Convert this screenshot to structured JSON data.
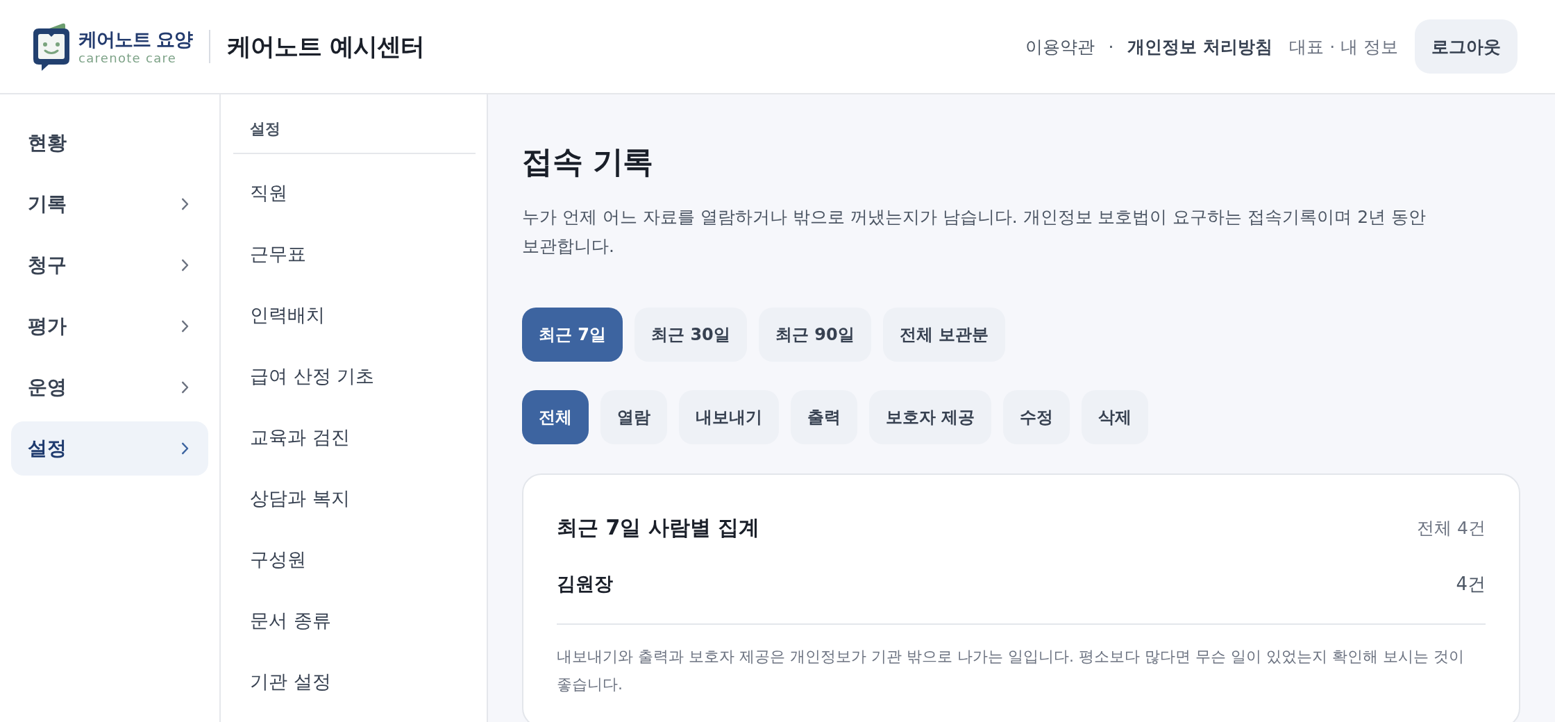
{
  "header": {
    "logo": {
      "name": "케어노트 요양",
      "tagline": "carenote care"
    },
    "center_name": "케어노트 예시센터",
    "links": [
      {
        "label": "이용약관",
        "kind": "plain"
      },
      {
        "label": "개인정보 처리방침",
        "kind": "strong"
      }
    ],
    "link_separator": "·",
    "account": "대표 · 내 정보",
    "logout_button": "로그아웃"
  },
  "sidebar": {
    "items": [
      {
        "label": "현황",
        "expandable": false,
        "selected": false
      },
      {
        "label": "기록",
        "expandable": true,
        "selected": false
      },
      {
        "label": "청구",
        "expandable": true,
        "selected": false
      },
      {
        "label": "평가",
        "expandable": true,
        "selected": false
      },
      {
        "label": "운영",
        "expandable": true,
        "selected": false
      },
      {
        "label": "설정",
        "expandable": true,
        "selected": true
      }
    ]
  },
  "submenu": {
    "title": "설정",
    "items": [
      {
        "label": "직원",
        "selected": false
      },
      {
        "label": "근무표",
        "selected": false
      },
      {
        "label": "인력배치",
        "selected": false
      },
      {
        "label": "급여 산정 기초",
        "selected": false
      },
      {
        "label": "교육과 검진",
        "selected": false
      },
      {
        "label": "상담과 복지",
        "selected": false
      },
      {
        "label": "구성원",
        "selected": false
      },
      {
        "label": "문서 종류",
        "selected": false
      },
      {
        "label": "기관 설정",
        "selected": false
      }
    ]
  },
  "main": {
    "title": "접속 기록",
    "description": "누가 언제 어느 자료를 열람하거나 밖으로 꺼냈는지가 남습니다. 개인정보 보호법이 요구하는 접속기록이며 2년 동안 보관합니다.",
    "period_filters": [
      {
        "label": "최근 7일",
        "selected": true
      },
      {
        "label": "최근 30일",
        "selected": false
      },
      {
        "label": "최근 90일",
        "selected": false
      },
      {
        "label": "전체 보관분",
        "selected": false
      }
    ],
    "type_filters": [
      {
        "label": "전체",
        "selected": true
      },
      {
        "label": "열람",
        "selected": false
      },
      {
        "label": "내보내기",
        "selected": false
      },
      {
        "label": "출력",
        "selected": false
      },
      {
        "label": "보호자 제공",
        "selected": false
      },
      {
        "label": "수정",
        "selected": false
      },
      {
        "label": "삭제",
        "selected": false
      }
    ],
    "summary": {
      "title": "최근 7일 사람별 집계",
      "total": "전체 4건",
      "rows": [
        {
          "name": "김원장",
          "count": "4건"
        }
      ],
      "note": "내보내기와 출력과 보호자 제공은 개인정보가 기관 밖으로 나가는 일입니다. 평소보다 많다면 무슨 일이 있었는지 확인해 보시는 것이 좋습니다."
    }
  }
}
